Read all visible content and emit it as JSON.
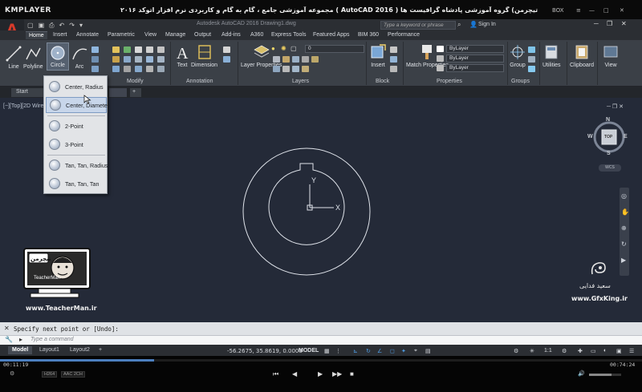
{
  "player": {
    "logo": "KMPLAYER",
    "title": "مجموعه آموزشی جامع ، گام به گام و کاربردی نرم افزار  اتوکد ۲۰۱۶ ( AutoCAD  2016 )   مدرس : سعید فدایی (تیچرمن) گروه آموزشی پادشاه گرافیست ها",
    "controls": [
      "BOX",
      "≡",
      "—",
      "□",
      "✕"
    ],
    "time_elapsed": "00:11:19",
    "time_total": "00:74:24",
    "progress": 0.24,
    "badges": [
      "H264",
      "AAC 2CH"
    ],
    "buttons": [
      "⏮",
      "◀",
      "▶",
      "▶▶",
      "■"
    ]
  },
  "app": {
    "logo_letter": "A",
    "title": "Autodesk AutoCAD 2016    Drawing1.dwg",
    "search_placeholder": "Type a keyword or phrase",
    "signin": "Sign In",
    "qat_icons": [
      "▢",
      "▣",
      "⎙",
      "↶",
      "↷",
      "▾"
    ]
  },
  "ribbon_tabs": [
    "Home",
    "Insert",
    "Annotate",
    "Parametric",
    "View",
    "Manage",
    "Output",
    "Add-ins",
    "A360",
    "Express Tools",
    "Featured Apps",
    "BIM 360",
    "Performance"
  ],
  "ribbon": {
    "draw_tools": [
      "Line",
      "Polyline",
      "Circle",
      "Arc"
    ],
    "big_tools": [
      "Text",
      "Dimension",
      "Layer Properties",
      "Insert",
      "Match Properties",
      "Group",
      "Utilities",
      "Clipboard",
      "View"
    ],
    "panels": [
      "Modify",
      "Annotation",
      "Layers",
      "Block",
      "Properties",
      "Groups"
    ],
    "layer_value": "0",
    "bylayer": [
      "ByLayer",
      "ByLayer",
      "ByLayer"
    ]
  },
  "file_tabs": [
    "Start",
    "+"
  ],
  "viewport_label": "[−][Top][2D Wireframe]",
  "circle_menu": {
    "items": [
      "Center, Radius",
      "Center, Diameter",
      "2-Point",
      "3-Point",
      "Tan, Tan, Radius",
      "Tan, Tan, Tan"
    ],
    "hover_index": 1
  },
  "viewcube": {
    "face": "TOP",
    "n": "N",
    "s": "S",
    "e": "E",
    "w": "W",
    "wcs": "WCS"
  },
  "watermarks": {
    "left_url": "www.TeacherMan.ir",
    "right_name": "سعید فدایی",
    "right_url": "www.GfxKing.ir",
    "left_badge_top": "تیچرمن",
    "left_badge_bottom": "TeacherMan"
  },
  "command": {
    "history": "Specify next point or [Undo]:",
    "placeholder": "Type a command"
  },
  "layout_tabs": [
    "Model",
    "Layout1",
    "Layout2",
    "+"
  ],
  "status": {
    "coords": "-56.2675, 35.8619, 0.0000",
    "mode": "MODEL",
    "scale": "1:1",
    "icons": [
      "▦",
      "⋮",
      "⊾",
      "↻",
      "∠",
      "◻",
      "✦",
      "⌖",
      "▤",
      "⚙",
      "☰"
    ]
  },
  "colors": {
    "accent": "#4f9de4",
    "canvas": "#242a38",
    "ribbon": "#3b4047"
  }
}
